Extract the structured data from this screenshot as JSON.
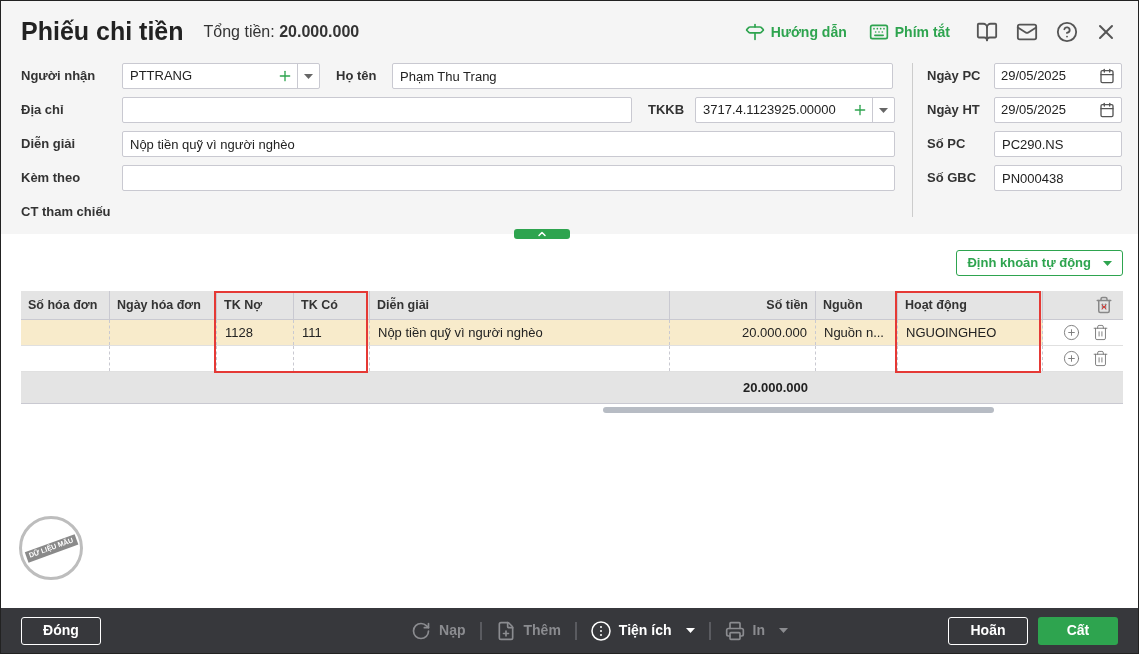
{
  "header": {
    "title": "Phiếu chi tiền",
    "total_label": "Tổng tiền:",
    "total_value": "20.000.000",
    "links": [
      {
        "kind": "guide",
        "label": "Hướng dẫn"
      },
      {
        "kind": "shortcut",
        "label": "Phím tắt"
      }
    ]
  },
  "form": {
    "recipient": {
      "label": "Người nhận",
      "value": "PTTRANG"
    },
    "full_name": {
      "label": "Họ tên",
      "value": "Phạm Thu Trang"
    },
    "address": {
      "label": "Địa chỉ"
    },
    "bank_account": {
      "label": "TKKB",
      "value": "3717.4.1123925.00000"
    },
    "description": {
      "label": "Diễn giải",
      "value": "Nộp tiền quỹ vì người nghèo"
    },
    "attachment": {
      "label": "Kèm theo"
    },
    "reference": {
      "label": "CT tham chiếu"
    }
  },
  "side_fields": [
    {
      "kind": "date",
      "label": "Ngày PC",
      "value": "29/05/2025"
    },
    {
      "kind": "date",
      "label": "Ngày HT",
      "value": "29/05/2025"
    },
    {
      "kind": "text",
      "label": "Số PC",
      "value": "PC290.NS"
    },
    {
      "kind": "text",
      "label": "Số GBC",
      "value": "PN000438"
    }
  ],
  "auto_entry_button": "Định khoản tự động",
  "table": {
    "columns": [
      {
        "label": "Số hóa đơn",
        "kind": "text",
        "highlighted": false
      },
      {
        "label": "Ngày hóa đơn",
        "kind": "text",
        "highlighted": false
      },
      {
        "label": "TK Nợ",
        "kind": "text",
        "highlighted": true
      },
      {
        "label": "TK Có",
        "kind": "text",
        "highlighted": true
      },
      {
        "label": "Diễn giải",
        "kind": "text",
        "highlighted": false
      },
      {
        "label": "Số tiền",
        "kind": "amount",
        "highlighted": false
      },
      {
        "label": "Nguồn",
        "kind": "text",
        "highlighted": false
      },
      {
        "label": "Hoạt động",
        "kind": "text",
        "highlighted": true
      }
    ],
    "rows": [
      {
        "selected": true,
        "cells": [
          "",
          "",
          "1128",
          "111",
          "Nộp tiền quỹ vì người nghèo",
          "20.000.000",
          "Nguồn n...",
          "NGUOINGHEO"
        ]
      },
      {
        "selected": false,
        "cells": [
          "",
          "",
          "",
          "",
          "",
          "",
          "",
          ""
        ]
      }
    ],
    "total": "20.000.000"
  },
  "stamp": "DỮ LIỆU MẪU",
  "footer": {
    "close": "Đóng",
    "tools": [
      {
        "kind": "reload",
        "label": "Nạp",
        "disabled": true,
        "menu": false
      },
      {
        "kind": "add",
        "label": "Thêm",
        "disabled": true,
        "menu": false
      },
      {
        "kind": "utilities",
        "label": "Tiện ích",
        "disabled": false,
        "menu": true
      },
      {
        "kind": "print",
        "label": "In",
        "disabled": true,
        "menu": true
      }
    ],
    "cancel": "Hoãn",
    "save": "Cất"
  }
}
